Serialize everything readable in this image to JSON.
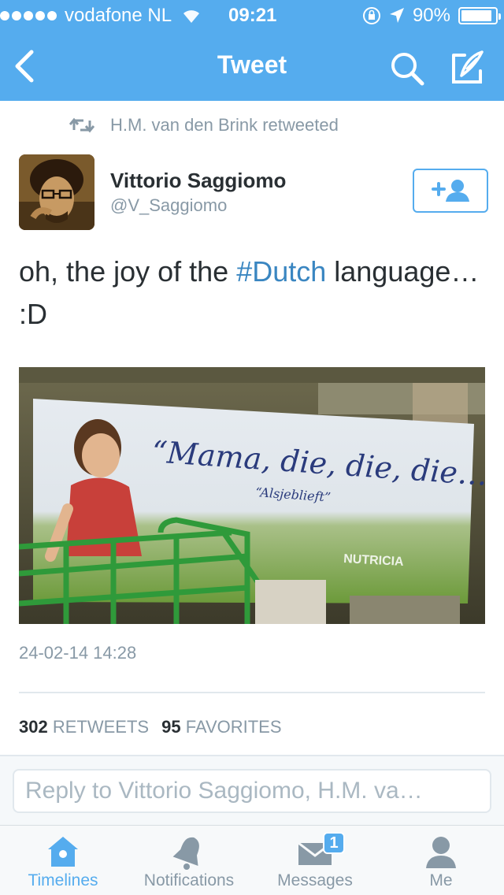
{
  "status_bar": {
    "carrier": "vodafone NL",
    "time": "09:21",
    "battery": "90%",
    "battery_level": 0.9
  },
  "nav": {
    "title": "Tweet"
  },
  "retweet_line": {
    "text": "H.M. van den Brink retweeted"
  },
  "tweet": {
    "author_name": "Vittorio Saggiomo",
    "author_handle": "@V_Saggiomo",
    "text_before": "oh, the joy of the ",
    "hashtag": "#Dutch",
    "text_after": " language… :D",
    "photo": {
      "quote": "“Mama, die, die, die…”",
      "subquote": "“Alsjeblieft”",
      "brand": "NUTRICIA"
    },
    "timestamp": "24-02-14 14:28"
  },
  "stats": {
    "retweets_count": "302",
    "retweets_label": "RETWEETS",
    "favorites_count": "95",
    "favorites_label": "FAVORITES"
  },
  "reply": {
    "placeholder": "Reply to Vittorio Saggiomo, H.M. va…"
  },
  "tabs": [
    {
      "label": "Timelines",
      "icon": "home-icon",
      "active": true
    },
    {
      "label": "Notifications",
      "icon": "bell-icon"
    },
    {
      "label": "Messages",
      "icon": "envelope-icon",
      "badge": "1"
    },
    {
      "label": "Me",
      "icon": "person-icon"
    }
  ],
  "colors": {
    "accent": "#55acee",
    "hashtag": "#3a86c1",
    "muted": "#8899a6"
  }
}
